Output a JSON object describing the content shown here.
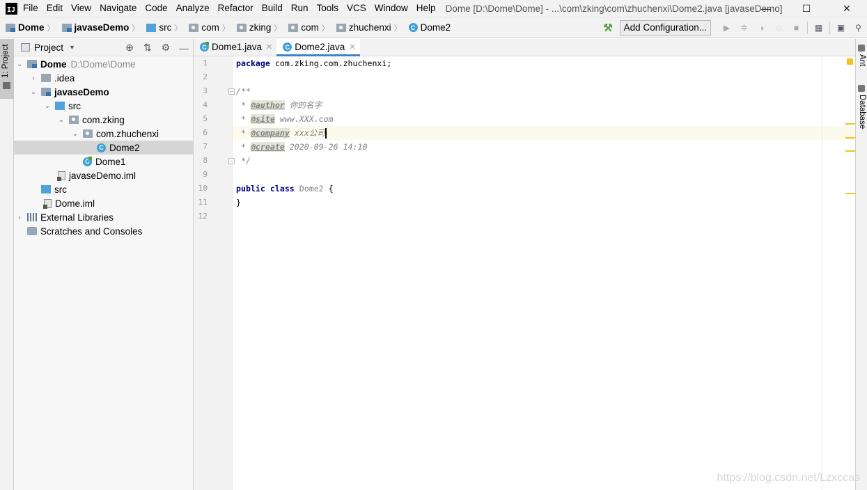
{
  "app": {
    "logo": "IJ",
    "window_title": "Dome [D:\\Dome\\Dome] - ...\\com\\zking\\com\\zhuchenxi\\Dome2.java [javaseDemo]"
  },
  "menu": [
    "File",
    "Edit",
    "View",
    "Navigate",
    "Code",
    "Analyze",
    "Refactor",
    "Build",
    "Run",
    "Tools",
    "VCS",
    "Window",
    "Help"
  ],
  "window_controls": {
    "minimize": "—",
    "maximize": "☐",
    "close": "✕"
  },
  "breadcrumbs": [
    "Dome",
    "javaseDemo",
    "src",
    "com",
    "zking",
    "com",
    "zhuchenxi",
    "Dome2"
  ],
  "toolbar": {
    "add_configuration": "Add Configuration..."
  },
  "left_stripe": {
    "project_tab": "1: Project"
  },
  "project_panel": {
    "title": "Project",
    "tree": [
      {
        "label": "Dome",
        "hint": "D:\\Dome\\Dome"
      },
      {
        "label": ".idea"
      },
      {
        "label": "javaseDemo"
      },
      {
        "label": "src"
      },
      {
        "label": "com.zking"
      },
      {
        "label": "com.zhuchenxi"
      },
      {
        "label": "Dome2"
      },
      {
        "label": "Dome1"
      },
      {
        "label": "javaseDemo.iml"
      },
      {
        "label": "src"
      },
      {
        "label": "Dome.iml"
      },
      {
        "label": "External Libraries"
      },
      {
        "label": "Scratches and Consoles"
      }
    ]
  },
  "editor": {
    "tabs": [
      {
        "label": "Dome1.java",
        "active": false
      },
      {
        "label": "Dome2.java",
        "active": true
      }
    ],
    "line_numbers": [
      "1",
      "2",
      "3",
      "4",
      "5",
      "6",
      "7",
      "8",
      "9",
      "10",
      "11",
      "12"
    ],
    "code": {
      "l1_kw": "package",
      "l1_rest": " com.zking.com.zhuchenxi;",
      "l3": "/**",
      "l4_pre": " * ",
      "l4_tag": "@author",
      "l4_val": " 你的名字",
      "l5_pre": " * ",
      "l5_tag": "@site",
      "l5_val": " www.XXX.com",
      "l6_pre": " * ",
      "l6_tag": "@company",
      "l6_val": " xxx公司",
      "l7_pre": " * ",
      "l7_tag": "@create",
      "l7_val": " 2020-09-26 14:10",
      "l8": " */",
      "l10_kw1": "public",
      "l10_kw2": "class",
      "l10_name": "Dome2",
      "l10_rest": " {",
      "l11": "}"
    }
  },
  "right_stripe": {
    "ant": "Ant",
    "database": "Database"
  },
  "watermark": "https://blog.csdn.net/Lzxccas",
  "colors": {
    "keyword": "#000080",
    "comment": "#808080",
    "accent": "#4083c9",
    "warning": "#f0c419"
  }
}
